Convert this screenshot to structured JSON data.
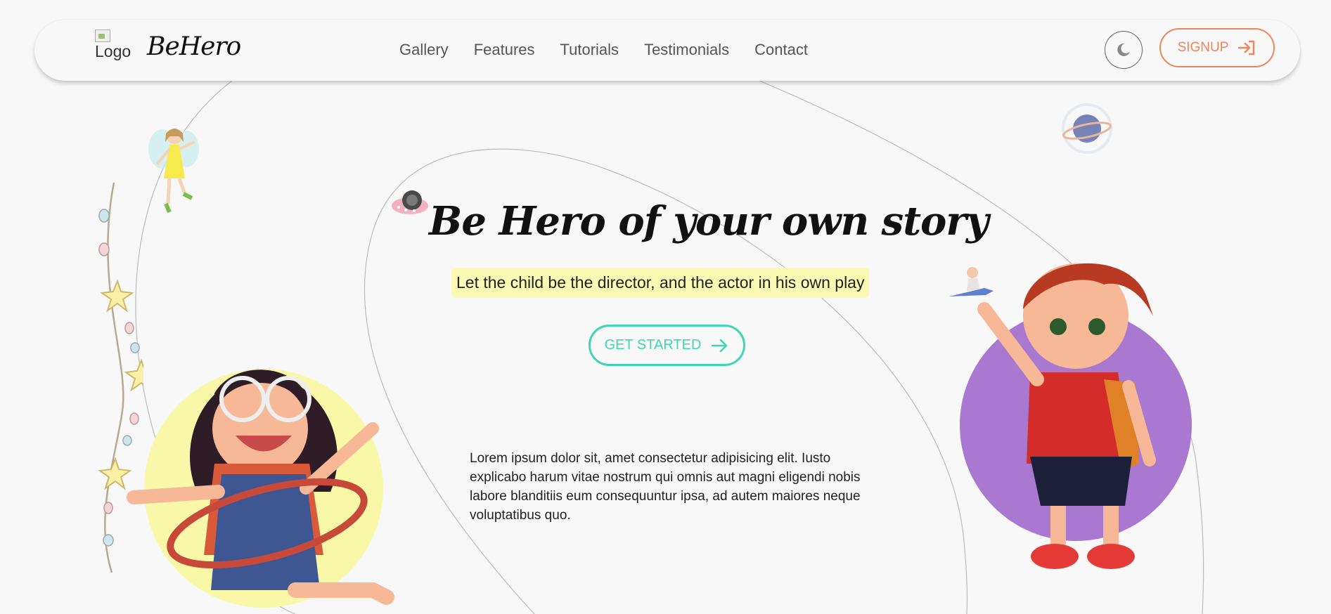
{
  "header": {
    "logo_alt": "Logo",
    "brand": "BeHero",
    "nav": [
      "Gallery",
      "Features",
      "Tutorials",
      "Testimonials",
      "Contact"
    ],
    "theme_toggle_icon": "moon-icon",
    "signup_label": "SIGNUP",
    "signup_icon": "login-arrow-icon"
  },
  "hero": {
    "title": "Be Hero of your own story",
    "subtitle": "Let the child be the director, and the actor in his own play",
    "cta_label": "GET STARTED",
    "cta_icon": "arrow-right-icon",
    "description": "Lorem ipsum dolor sit, amet consectetur adipisicing elit. Iusto explicabo harum vitae nostrum qui omnis aut magni eligendi nobis labore blanditiis eum consequuntur ipsa, ad autem maiores neque voluptatibus quo."
  },
  "colors": {
    "accent_signup": "#f0845a",
    "accent_cta": "#3fd6b0",
    "highlight": "#fafab2",
    "circle_yellow": "#f9f8a8",
    "circle_purple": "#a978d1"
  },
  "illustrations": [
    "fairy-illustration",
    "ufo-illustration",
    "planet-illustration",
    "star-garland-illustration",
    "girl-hula-hoop-illustration",
    "boy-pointing-illustration",
    "kid-on-pencil-illustration"
  ]
}
